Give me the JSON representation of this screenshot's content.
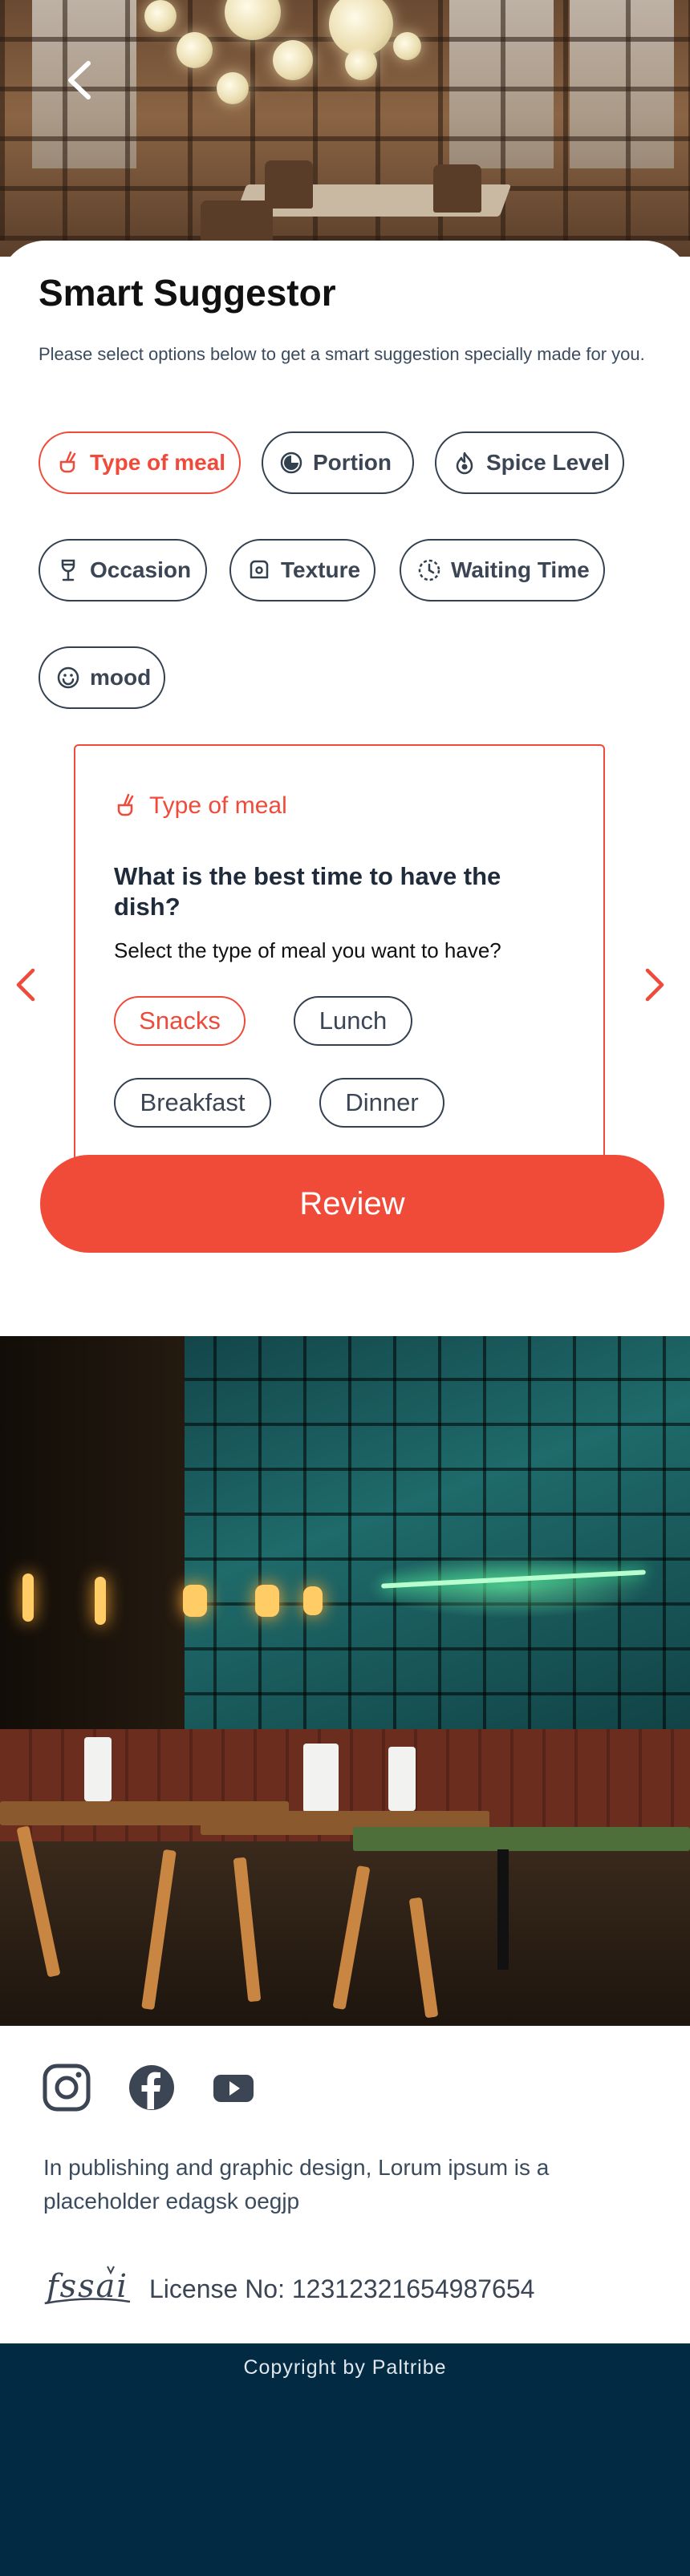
{
  "header": {
    "back_icon": "chevron-left-icon"
  },
  "suggestor": {
    "title": "Smart Suggestor",
    "subtitle": "Please select options below to get a smart suggestion specially made for you.",
    "categories": [
      {
        "label": "Type of meal",
        "icon": "meal-icon",
        "active": true
      },
      {
        "label": "Portion",
        "icon": "portion-icon",
        "active": false
      },
      {
        "label": "Spice Level",
        "icon": "flame-icon",
        "active": false
      },
      {
        "label": "Occasion",
        "icon": "glass-icon",
        "active": false
      },
      {
        "label": "Texture",
        "icon": "bread-icon",
        "active": false
      },
      {
        "label": "Waiting Time",
        "icon": "timer-icon",
        "active": false
      },
      {
        "label": "mood",
        "icon": "smiley-icon",
        "active": false
      }
    ],
    "panel": {
      "heading": "Type of meal",
      "question": "What is the best time to have the dish?",
      "instruction": "Select the type of meal you want to have?",
      "options": [
        {
          "label": "Snacks",
          "active": true
        },
        {
          "label": "Lunch",
          "active": false
        },
        {
          "label": "Breakfast",
          "active": false
        },
        {
          "label": "Dinner",
          "active": false
        }
      ]
    },
    "review_label": "Review"
  },
  "footer": {
    "social_icons": [
      "instagram-icon",
      "facebook-icon",
      "youtube-icon"
    ],
    "description": "In publishing and graphic design, Lorum ipsum is a placeholder edagsk oegjp",
    "fssai_logo_text": "fssai",
    "license": "License No: 12312321654987654",
    "copyright": "Copyright by Paltribe"
  },
  "colors": {
    "accent": "#f04a39",
    "text_dark": "#3b4554",
    "footer_bar": "#022a42"
  }
}
